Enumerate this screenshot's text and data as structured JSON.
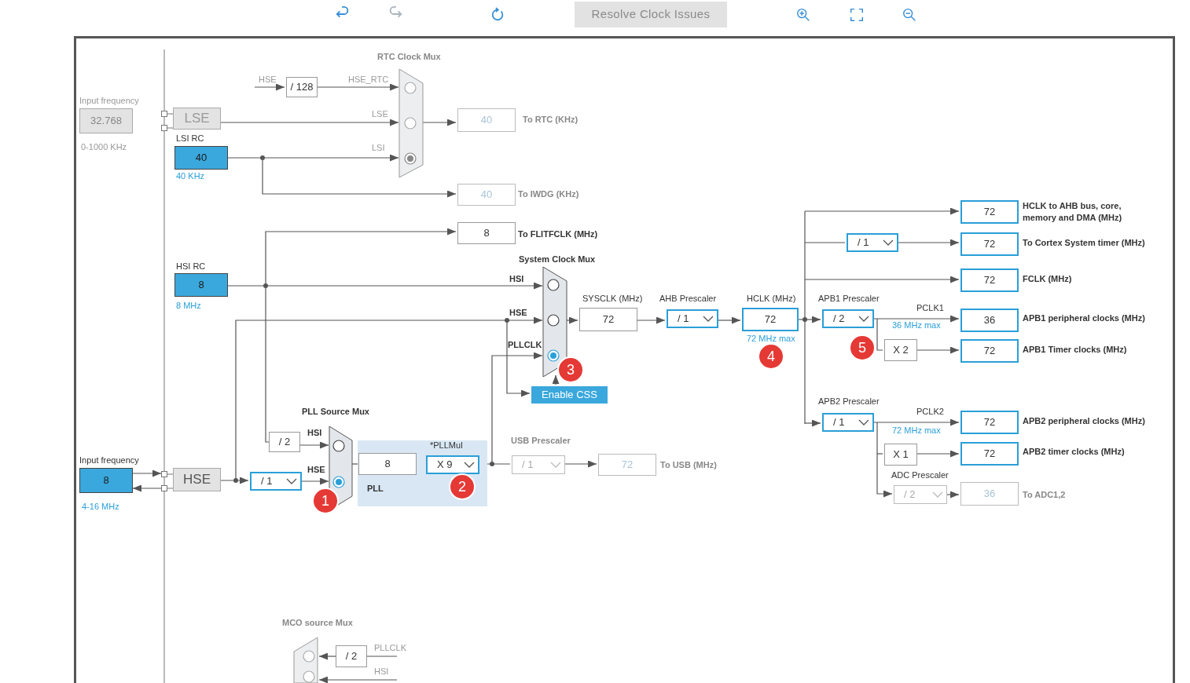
{
  "tools": [
    {
      "kind": "undo",
      "disabled": false
    },
    {
      "kind": "redo",
      "disabled": true
    },
    {
      "kind": "refresh",
      "disabled": false
    },
    {
      "kind": "resolve",
      "label": "Resolve Clock Issues",
      "disabled": true
    },
    {
      "kind": "zoom-in",
      "disabled": false
    },
    {
      "kind": "fit",
      "disabled": false
    },
    {
      "kind": "zoom-out",
      "disabled": false
    }
  ],
  "diagram": {
    "labels": [
      {
        "text": "RTC Clock Mux",
        "kind": "muted-heading"
      },
      {
        "text": "Input frequency",
        "kind": "muted"
      },
      {
        "text": "HSE",
        "kind": "muted"
      },
      {
        "text": "HSE_RTC",
        "kind": "muted"
      },
      {
        "text": "LSE",
        "kind": "muted"
      },
      {
        "text": "To RTC (KHz)",
        "kind": "muted-heading"
      },
      {
        "text": "0-1000 KHz",
        "kind": "muted"
      },
      {
        "text": "LSI RC",
        "kind": "caption"
      },
      {
        "text": "LSI",
        "kind": "muted"
      },
      {
        "text": "40 KHz",
        "kind": "hint"
      },
      {
        "text": "To IWDG (KHz)",
        "kind": "muted-heading"
      },
      {
        "text": "To FLITFCLK (MHz)",
        "kind": "heading"
      },
      {
        "text": "HCLK to AHB bus, core,",
        "kind": "heading"
      },
      {
        "text": "memory and DMA (MHz)",
        "kind": "heading"
      },
      {
        "text": "To Cortex System timer (MHz)",
        "kind": "heading"
      },
      {
        "text": "System Clock Mux",
        "kind": "heading"
      },
      {
        "text": "HSI RC",
        "kind": "caption"
      },
      {
        "text": "FCLK (MHz)",
        "kind": "heading"
      },
      {
        "text": "HSI",
        "kind": "heading"
      },
      {
        "text": "SYSCLK (MHz)",
        "kind": "caption"
      },
      {
        "text": "AHB Prescaler",
        "kind": "caption"
      },
      {
        "text": "HCLK (MHz)",
        "kind": "caption"
      },
      {
        "text": "APB1 Prescaler",
        "kind": "caption"
      },
      {
        "text": "8 MHz",
        "kind": "hint"
      },
      {
        "text": "PCLK1",
        "kind": "caption"
      },
      {
        "text": "HSE",
        "kind": "heading"
      },
      {
        "text": "APB1 peripheral clocks (MHz)",
        "kind": "heading"
      },
      {
        "text": "36 MHz max",
        "kind": "hint"
      },
      {
        "text": "72 MHz max",
        "kind": "hint"
      },
      {
        "text": "PLLCLK",
        "kind": "heading"
      },
      {
        "text": "APB1 Timer clocks (MHz)",
        "kind": "heading"
      },
      {
        "text": "APB2 Prescaler",
        "kind": "caption"
      },
      {
        "text": "PCLK2",
        "kind": "caption"
      },
      {
        "text": "PLL Source Mux",
        "kind": "heading"
      },
      {
        "text": "APB2 peripheral clocks (MHz)",
        "kind": "heading"
      },
      {
        "text": "72 MHz max",
        "kind": "hint"
      },
      {
        "text": "HSI",
        "kind": "heading"
      },
      {
        "text": "USB Prescaler",
        "kind": "muted-heading"
      },
      {
        "text": "*PLLMul",
        "kind": "caption"
      },
      {
        "text": "APB2 timer clocks (MHz)",
        "kind": "heading"
      },
      {
        "text": "Input frequency",
        "kind": "caption"
      },
      {
        "text": "To USB (MHz)",
        "kind": "muted-heading"
      },
      {
        "text": "HSE",
        "kind": "heading"
      },
      {
        "text": "ADC Prescaler",
        "kind": "caption"
      },
      {
        "text": "PLL",
        "kind": "heading"
      },
      {
        "text": "To ADC1,2",
        "kind": "muted-heading"
      },
      {
        "text": "4-16 MHz",
        "kind": "hint"
      },
      {
        "text": "MCO source Mux",
        "kind": "muted-heading"
      },
      {
        "text": "PLLCLK",
        "kind": "muted"
      },
      {
        "text": "HSI",
        "kind": "muted"
      }
    ],
    "boxes": [
      {
        "value": "/ 128",
        "kind": "plain"
      },
      {
        "value": "32.768",
        "kind": "fixed"
      },
      {
        "value": "LSE",
        "kind": "block-off"
      },
      {
        "value": "40",
        "kind": "inactive"
      },
      {
        "value": "40",
        "kind": "source"
      },
      {
        "value": "40",
        "kind": "inactive"
      },
      {
        "value": "72",
        "kind": "output"
      },
      {
        "value": "8",
        "kind": "plain"
      },
      {
        "value": "72",
        "kind": "output"
      },
      {
        "value": "72",
        "kind": "output"
      },
      {
        "value": "8",
        "kind": "source"
      },
      {
        "value": "72",
        "kind": "plain"
      },
      {
        "value": "72",
        "kind": "output"
      },
      {
        "value": "36",
        "kind": "output"
      },
      {
        "value": "X 2",
        "kind": "plain"
      },
      {
        "value": "72",
        "kind": "output"
      },
      {
        "value": "72",
        "kind": "output"
      },
      {
        "value": "/ 2",
        "kind": "plain"
      },
      {
        "value": "8",
        "kind": "plain"
      },
      {
        "value": "72",
        "kind": "inactive"
      },
      {
        "value": "X 1",
        "kind": "plain"
      },
      {
        "value": "72",
        "kind": "output"
      },
      {
        "value": "8",
        "kind": "source"
      },
      {
        "value": "HSE",
        "kind": "block"
      },
      {
        "value": "36",
        "kind": "inactive"
      },
      {
        "value": "/ 2",
        "kind": "plain"
      }
    ],
    "selects": [
      {
        "value": "/ 1",
        "disabled": false
      },
      {
        "value": "/ 1",
        "disabled": false
      },
      {
        "value": "/ 2",
        "disabled": false
      },
      {
        "value": "/ 1",
        "disabled": false
      },
      {
        "value": "X 9",
        "disabled": false
      },
      {
        "value": "/ 1",
        "disabled": true
      },
      {
        "value": "/ 1",
        "disabled": false
      },
      {
        "value": "/ 2",
        "disabled": true
      }
    ],
    "muxes": [
      {
        "disabled": true,
        "options": [
          {
            "selected": false
          },
          {
            "selected": false
          },
          {
            "selected": true
          }
        ]
      },
      {
        "disabled": false,
        "options": [
          {
            "selected": false
          },
          {
            "selected": false
          },
          {
            "selected": true
          }
        ]
      },
      {
        "disabled": false,
        "options": [
          {
            "selected": false
          },
          {
            "selected": true
          }
        ]
      },
      {
        "disabled": true,
        "options": [
          {
            "selected": false
          },
          {
            "selected": false
          }
        ]
      }
    ],
    "css_button": "Enable CSS",
    "badges": [
      "1",
      "2",
      "3",
      "4",
      "5"
    ]
  }
}
